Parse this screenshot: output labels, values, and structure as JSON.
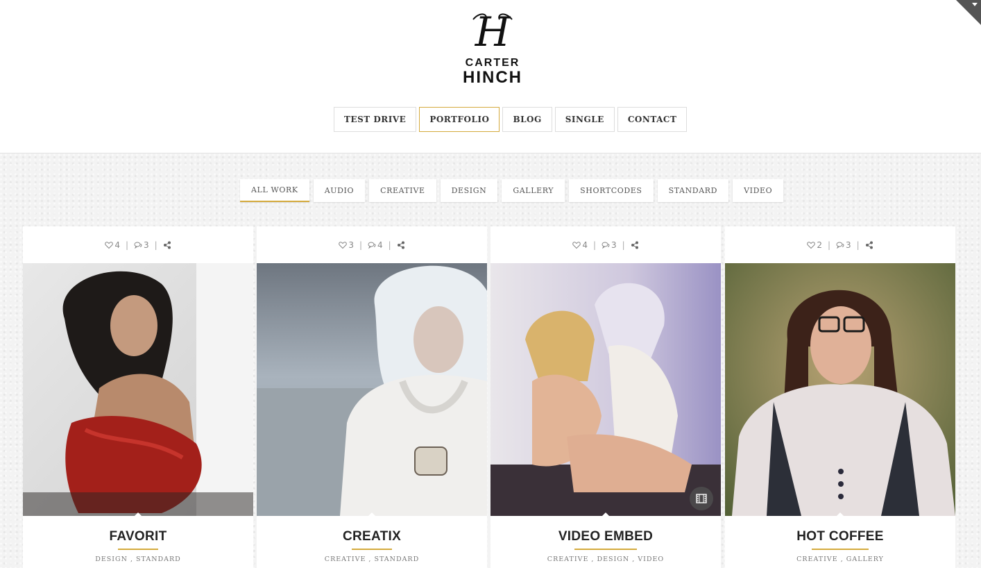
{
  "logo": {
    "mark": "H",
    "line1": "CARTER",
    "line2": "HINCH"
  },
  "main_nav": [
    {
      "label": "TEST DRIVE",
      "active": false
    },
    {
      "label": "PORTFOLIO",
      "active": true
    },
    {
      "label": "BLOG",
      "active": false
    },
    {
      "label": "SINGLE",
      "active": false
    },
    {
      "label": "CONTACT",
      "active": false
    }
  ],
  "filters": [
    {
      "label": "ALL WORK",
      "active": true
    },
    {
      "label": "AUDIO",
      "active": false
    },
    {
      "label": "CREATIVE",
      "active": false
    },
    {
      "label": "DESIGN",
      "active": false
    },
    {
      "label": "GALLERY",
      "active": false
    },
    {
      "label": "SHORTCODES",
      "active": false
    },
    {
      "label": "STANDARD",
      "active": false
    },
    {
      "label": "VIDEO",
      "active": false
    }
  ],
  "cards": [
    {
      "likes": "4",
      "comments": "3",
      "title": "FAVORIT",
      "categories": [
        "DESIGN",
        "STANDARD"
      ],
      "video": false
    },
    {
      "likes": "3",
      "comments": "4",
      "title": "CREATIX",
      "categories": [
        "CREATIVE",
        "STANDARD"
      ],
      "video": false
    },
    {
      "likes": "4",
      "comments": "3",
      "title": "VIDEO EMBED",
      "categories": [
        "CREATIVE",
        "DESIGN",
        "VIDEO"
      ],
      "video": true
    },
    {
      "likes": "2",
      "comments": "3",
      "title": "HOT COFFEE",
      "categories": [
        "CREATIVE",
        "GALLERY"
      ],
      "video": false
    }
  ],
  "icons": {
    "like": "heart-icon",
    "comment": "comments-icon",
    "share": "share-icon",
    "video": "film-icon",
    "corner": "chevron-down-icon"
  },
  "colors": {
    "accent": "#d4aa3c",
    "background": "#f3f3f3",
    "card": "#ffffff"
  }
}
